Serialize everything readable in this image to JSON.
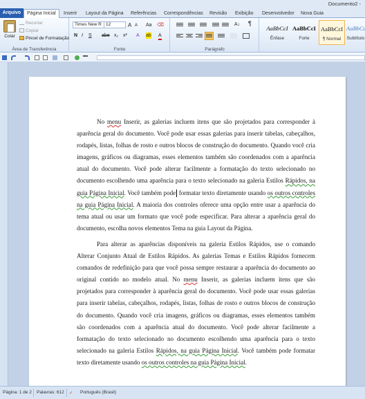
{
  "window": {
    "title": "Documento2 -"
  },
  "tabs": [
    "Arquivo",
    "Página Inicial",
    "Inserir",
    "Layout da Página",
    "Referências",
    "Correspondências",
    "Revisão",
    "Exibição",
    "Desenvolvedor",
    "Nova Guia"
  ],
  "active_tab": "Página Inicial",
  "clipboard": {
    "paste_label": "Colar",
    "cut_label": "Recortar",
    "copy_label": "Copiar",
    "format_painter_label": "Pincel de Formatação",
    "group_label": "Área de Transferência"
  },
  "font": {
    "family": "Times New R",
    "size": "12",
    "group_label": "Fonte",
    "grow_label": "A",
    "shrink_label": "A",
    "case_label": "Aa",
    "bold": "N",
    "italic": "I",
    "underline": "S",
    "strike": "abe",
    "subscript": "x₂",
    "superscript": "x²",
    "highlight_label": "A",
    "color_label": "A"
  },
  "paragraph": {
    "group_label": "Parágrafo",
    "marks": "¶"
  },
  "styles": [
    {
      "sample": "AaBbCcI",
      "name": "Ênfase"
    },
    {
      "sample": "AaBbCcI",
      "name": "Forte"
    },
    {
      "sample": "AaBbCcI",
      "name": "¶ Normal"
    },
    {
      "sample": "AaBbCc",
      "name": "Subtítulo"
    }
  ],
  "colors": {
    "accent": "#2a5fb0",
    "ribbon": "#dfe9f5",
    "workspace": "#c2d1e6"
  },
  "document": {
    "p1": [
      {
        "t": "No ",
        "s": ""
      },
      {
        "t": "menu",
        "s": "red"
      },
      {
        "t": " Inserir, as galerias incluem itens que são projetados para corresponder à aparência geral do documento. Você pode usar essas galerias para inserir tabelas, cabeçalhos, rodapés, listas, folhas de rosto e outros blocos de construção do documento. Quando você cria imagens, gráficos ou diagramas, esses elementos também são coordenados com a aparência atual do documento. Você pode alterar facilmente a formatação do texto selecionado no documento escolhendo uma aparência para o texto selecionado na galeria Estilos ",
        "s": ""
      },
      {
        "t": "Rápidos, na guia Página Inicial",
        "s": "green"
      },
      {
        "t": ". Você também pode",
        "s": ""
      },
      {
        "t": "",
        "s": "cursor"
      },
      {
        "t": " formatar texto diretamente usando ",
        "s": ""
      },
      {
        "t": "os outros controles na guia Página Inicial",
        "s": "green"
      },
      {
        "t": ". A maioria dos controles oferece uma opção entre usar a aparência do tema atual ou usar um formato que você pode especificar. Para alterar a aparência geral do documento, escolha novos elementos Tema na guia Layout da Página.",
        "s": ""
      }
    ],
    "p2": [
      {
        "t": "Para alterar as aparências disponíveis na galeria Estilos Rápidos, use o comando Alterar Conjunto Atual de Estilos Rápidos. As galerias Temas e Estilos Rápidos fornecem comandos de redefinição para que você possa sempre restaurar a aparência do documento ao original contido no modelo atual. No ",
        "s": ""
      },
      {
        "t": "menu",
        "s": "red"
      },
      {
        "t": " Inserir, as galerias incluem itens que são projetados para corresponder à aparência geral do documento. Você pode usar essas galerias para inserir tabelas, cabeçalhos, rodapés, listas, folhas de rosto e outros blocos de construção do documento. Quando você cria imagens, gráficos ou diagramas, esses elementos também são coordenados com a aparência atual do documento. Você pode alterar facilmente a formatação do texto selecionado no documento escolhendo uma aparência para o texto selecionado na galeria Estilos ",
        "s": ""
      },
      {
        "t": "Rápidos, na guia Página Inicial",
        "s": "green"
      },
      {
        "t": ". Você também pode formatar texto diretamente usando ",
        "s": ""
      },
      {
        "t": "os outros controles na guia Página Inicial",
        "s": "green"
      },
      {
        "t": ".",
        "s": ""
      }
    ]
  },
  "status": {
    "page": "Página: 1 de 2",
    "words": "Palavras: 612",
    "language": "Português (Brasil)"
  }
}
